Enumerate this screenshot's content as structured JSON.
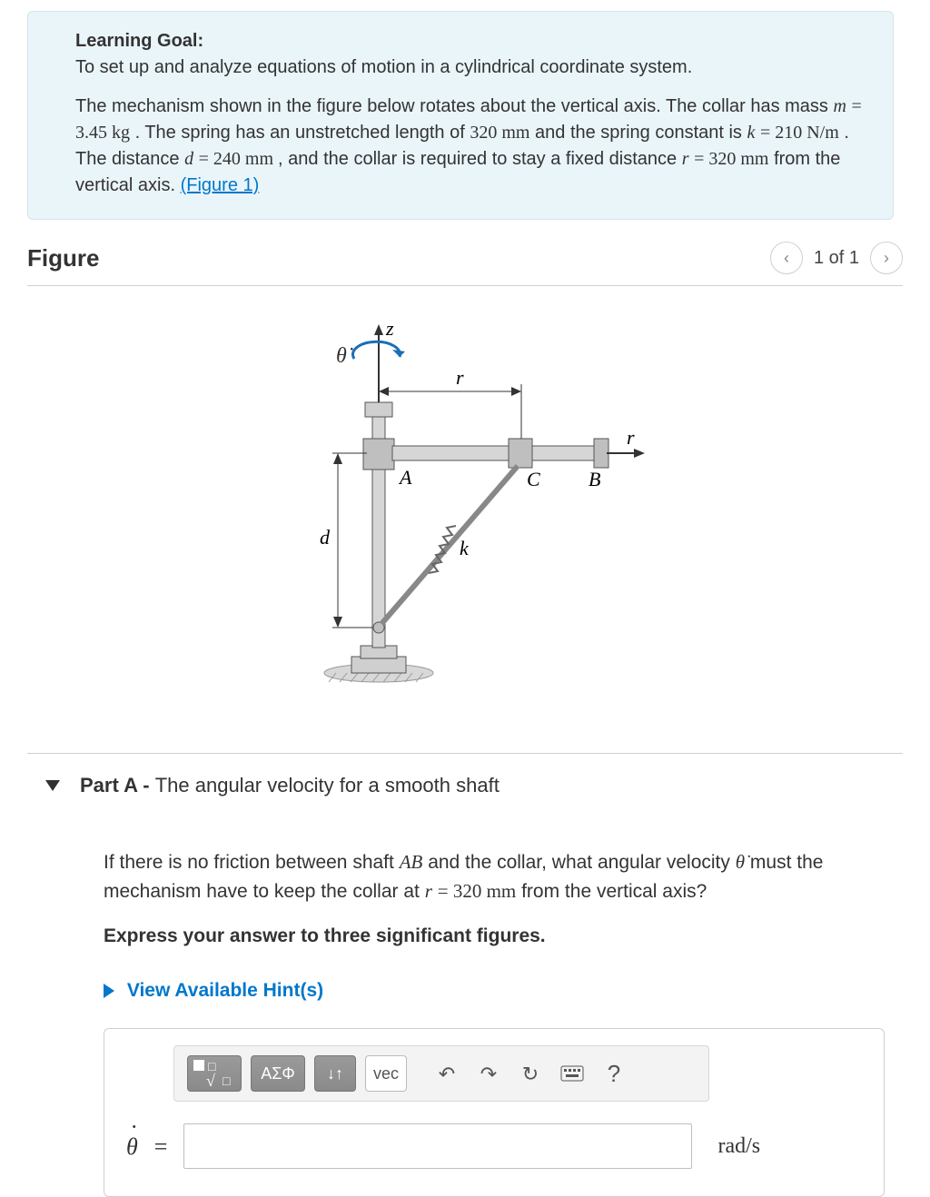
{
  "learning_goal": {
    "heading": "Learning Goal:",
    "line1": "To set up and analyze equations of motion in a cylindrical coordinate system.",
    "line2a": "The mechanism shown in the figure below rotates about the vertical axis. The collar has mass ",
    "m_sym": "m",
    "eq1": " = ",
    "m_val": "3.45 kg",
    "line2b": ". The spring has an unstretched length of ",
    "len_val": "320 mm",
    "line2c": " and the spring constant is ",
    "k_sym": "k",
    "k_val": " = 210 N/m",
    "line2d": ". The distance ",
    "d_sym": "d",
    "d_val": " = 240 mm ",
    "line2e": ", and the collar is required to stay a fixed distance ",
    "r_sym": "r",
    "r_val": " = 320 mm",
    "line2f": " from the vertical axis.",
    "fig_link": "(Figure 1)"
  },
  "figure": {
    "title": "Figure",
    "pager": "1 of 1",
    "labels": {
      "z": "z",
      "theta_dot": "θ̇",
      "r_top": "r",
      "r_right": "r",
      "A": "A",
      "B": "B",
      "C": "C",
      "d": "d",
      "k": "k"
    }
  },
  "partA": {
    "title_prefix": "Part A - ",
    "title_text": "The angular velocity for a smooth shaft",
    "q1a": "If there is no friction between shaft ",
    "q_ab": "AB",
    "q1b": " and the collar, what angular velocity ",
    "q_theta": "θ̇",
    "q1c": "  must the mechanism have to keep the collar at ",
    "q_r": "r",
    "q_eq": " = ",
    "q_rval": "320 mm",
    "q1d": " from the vertical axis?",
    "instr": "Express your answer to three significant figures.",
    "hints": "View Available Hint(s)",
    "toolbar": {
      "templates_sub": "x",
      "greek": "ΑΣΦ",
      "updown": "↓↑",
      "vec": "vec",
      "undo": "↶",
      "redo": "↷",
      "reset": "↻",
      "keyboard": "⌨",
      "help": "?"
    },
    "answer": {
      "var": "θ",
      "equals": "=",
      "value": "",
      "unit": "rad/s"
    }
  }
}
